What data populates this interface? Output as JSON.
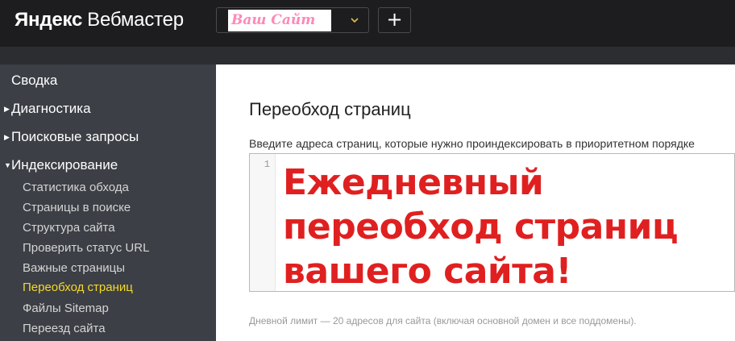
{
  "header": {
    "brand_yandex": "Яндекс",
    "brand_product": "Вебмастер",
    "site_selector": {
      "value": "Ваш Сайт",
      "icon": "chevron-down-icon"
    },
    "add_button_label": "+"
  },
  "sidebar": {
    "items": [
      {
        "label": "Сводка",
        "arrow": ""
      },
      {
        "label": "Диагностика",
        "arrow": "▶"
      },
      {
        "label": "Поисковые запросы",
        "arrow": "▶"
      },
      {
        "label": "Индексирование",
        "arrow": "▼"
      }
    ],
    "subitems": [
      {
        "label": "Статистика обхода",
        "active": false
      },
      {
        "label": "Страницы в поиске",
        "active": false
      },
      {
        "label": "Структура сайта",
        "active": false
      },
      {
        "label": "Проверить статус URL",
        "active": false
      },
      {
        "label": "Важные страницы",
        "active": false
      },
      {
        "label": "Переобход страниц",
        "active": true
      },
      {
        "label": "Файлы Sitemap",
        "active": false
      },
      {
        "label": "Переезд сайта",
        "active": false
      }
    ]
  },
  "main": {
    "title": "Переобход страниц",
    "field_label": "Введите адреса страниц, которые нужно проиндексировать в приоритетном порядке",
    "editor": {
      "line_number": "1",
      "promo_lines": [
        "Ежедневный",
        "переобход страниц",
        "вашего сайта!"
      ]
    },
    "limit_note": "Дневной лимит — 20 адресов для сайта (включая основной домен и все поддомены)."
  },
  "colors": {
    "topbar": "#1d1d1f",
    "sidebar": "#3c3f45",
    "active_item": "#f5d92b",
    "promo_text": "#e02020",
    "site_name": "#ff88b8"
  }
}
